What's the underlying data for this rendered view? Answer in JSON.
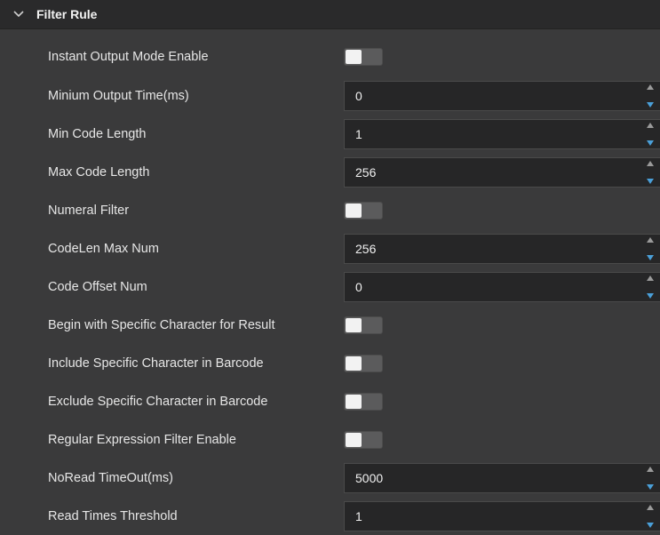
{
  "section": {
    "title": "Filter Rule",
    "icon": "chevron-down-icon",
    "expanded": true
  },
  "rows": [
    {
      "label": "Instant Output Mode Enable",
      "type": "toggle",
      "enabled": false
    },
    {
      "label": "Minium Output Time(ms)",
      "type": "spinbox",
      "value": "0"
    },
    {
      "label": "Min Code Length",
      "type": "spinbox",
      "value": "1"
    },
    {
      "label": "Max Code Length",
      "type": "spinbox",
      "value": "256"
    },
    {
      "label": "Numeral Filter",
      "type": "toggle",
      "enabled": false
    },
    {
      "label": "CodeLen Max Num",
      "type": "spinbox",
      "value": "256"
    },
    {
      "label": "Code Offset Num",
      "type": "spinbox",
      "value": "0"
    },
    {
      "label": "Begin with Specific Character for Result",
      "type": "toggle",
      "enabled": false
    },
    {
      "label": "Include Specific Character in Barcode",
      "type": "toggle",
      "enabled": false
    },
    {
      "label": "Exclude Specific Character in Barcode",
      "type": "toggle",
      "enabled": false
    },
    {
      "label": "Regular Expression Filter Enable",
      "type": "toggle",
      "enabled": false
    },
    {
      "label": "NoRead TimeOut(ms)",
      "type": "spinbox",
      "value": "5000"
    },
    {
      "label": "Read Times Threshold",
      "type": "spinbox",
      "value": "1"
    }
  ],
  "colors": {
    "background": "#3a3a3b",
    "header": "#2a2a2b",
    "input": "#262627",
    "accent": "#4a9fd8"
  }
}
